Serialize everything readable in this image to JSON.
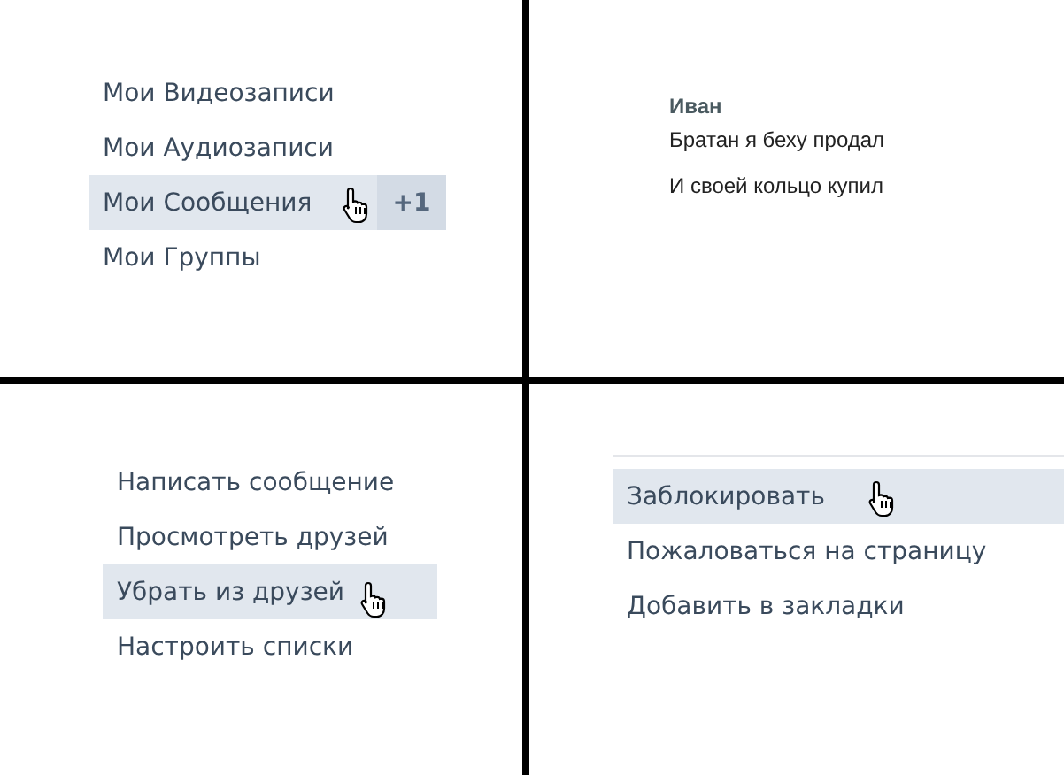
{
  "panels": [
    {
      "kind": "menu",
      "items": [
        {
          "label": "Мои Видеозаписи",
          "selected": false
        },
        {
          "label": "Мои Аудиозаписи",
          "selected": false
        },
        {
          "label": "Мои Сообщения",
          "selected": true,
          "badge": "+1"
        },
        {
          "label": "Мои Группы",
          "selected": false
        }
      ]
    },
    {
      "kind": "message",
      "author": "Иван",
      "lines": [
        "Братан я беху продал",
        "И своей кольцо купил"
      ]
    },
    {
      "kind": "menu",
      "items": [
        {
          "label": "Написать сообщение",
          "selected": false
        },
        {
          "label": "Просмотреть друзей",
          "selected": false
        },
        {
          "label": "Убрать из друзей",
          "selected": true
        },
        {
          "label": "Настроить списки",
          "selected": false
        }
      ]
    },
    {
      "kind": "menu",
      "items": [
        {
          "label": "Заблокировать",
          "selected": true
        },
        {
          "label": "Пожаловаться на страницу",
          "selected": false
        },
        {
          "label": "Добавить в закладки",
          "selected": false
        }
      ]
    }
  ]
}
